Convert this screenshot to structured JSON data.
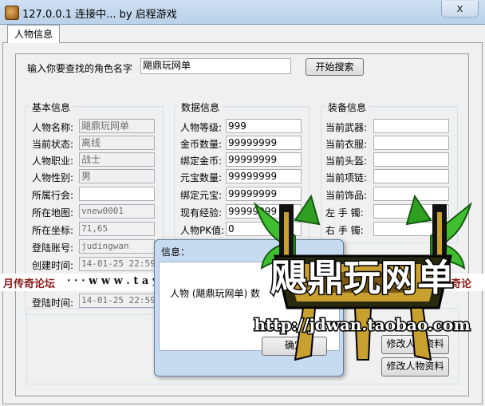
{
  "window": {
    "title": "127.0.0.1  连接中... by 启程游戏",
    "close_glyph": "x"
  },
  "tabs": [
    {
      "label": "人物信息"
    }
  ],
  "search": {
    "label": "输入你要查找的角色名字",
    "value": "飓鼎玩网单",
    "button": "开始搜索"
  },
  "basic": {
    "title": "基本信息",
    "fields": [
      {
        "label": "人物名称:",
        "value": "飓鼎玩网单"
      },
      {
        "label": "当前状态:",
        "value": "离线"
      },
      {
        "label": "人物职业:",
        "value": "战士"
      },
      {
        "label": "人物性别:",
        "value": "男"
      },
      {
        "label": "所属行会:",
        "value": ""
      },
      {
        "label": "所在地图:",
        "value": "vnew0001"
      },
      {
        "label": "所在坐标:",
        "value": "71,65"
      },
      {
        "label": "登陆账号:",
        "value": "judingwan"
      },
      {
        "label": "创建时间:",
        "value": "14-01-25 22:59"
      },
      {
        "label": "登陆时间:",
        "value": "14-01-25 22:59"
      }
    ]
  },
  "stats": {
    "title": "数据信息",
    "fields": [
      {
        "label": "人物等级:",
        "value": "999"
      },
      {
        "label": "金币数量:",
        "value": "99999999"
      },
      {
        "label": "绑定金币:",
        "value": "99999999"
      },
      {
        "label": "元宝数量:",
        "value": "99999999"
      },
      {
        "label": "绑定元宝:",
        "value": "99999999"
      },
      {
        "label": "现有经验:",
        "value": "99999999"
      },
      {
        "label": "人物PK值:",
        "value": "0"
      }
    ]
  },
  "equip": {
    "title": "装备信息",
    "fields": [
      {
        "label": "当前武器:",
        "value": ""
      },
      {
        "label": "当前衣服:",
        "value": ""
      },
      {
        "label": "当前头盔:",
        "value": ""
      },
      {
        "label": "当前项链:",
        "value": ""
      },
      {
        "label": "当前饰品:",
        "value": ""
      },
      {
        "label": "左 手 镯:",
        "value": ""
      },
      {
        "label": "右 手 镯:",
        "value": ""
      }
    ]
  },
  "actions": {
    "modify_items": "修改人物资料",
    "modify_profile": "修改人物资料"
  },
  "watermark": {
    "left": "月传奇论坛",
    "url1": "· · · w w w . t a y u e 2 0 1 3 . c o m",
    "url2": "w w w . t a y u e 2 0 1 3 . c n",
    "right": "踏月传奇论",
    "logo_name": "飓鼎玩网单",
    "logo_url": "http://jdwan.taobao.com"
  },
  "dialog": {
    "title": "信息：",
    "message": "人物 (飓鼎玩网单) 数",
    "ok": "确定"
  },
  "colors": {
    "title_bar": "#b9d1ea",
    "logo_green": "#3fbf2f",
    "logo_gold": "#c8a030"
  }
}
